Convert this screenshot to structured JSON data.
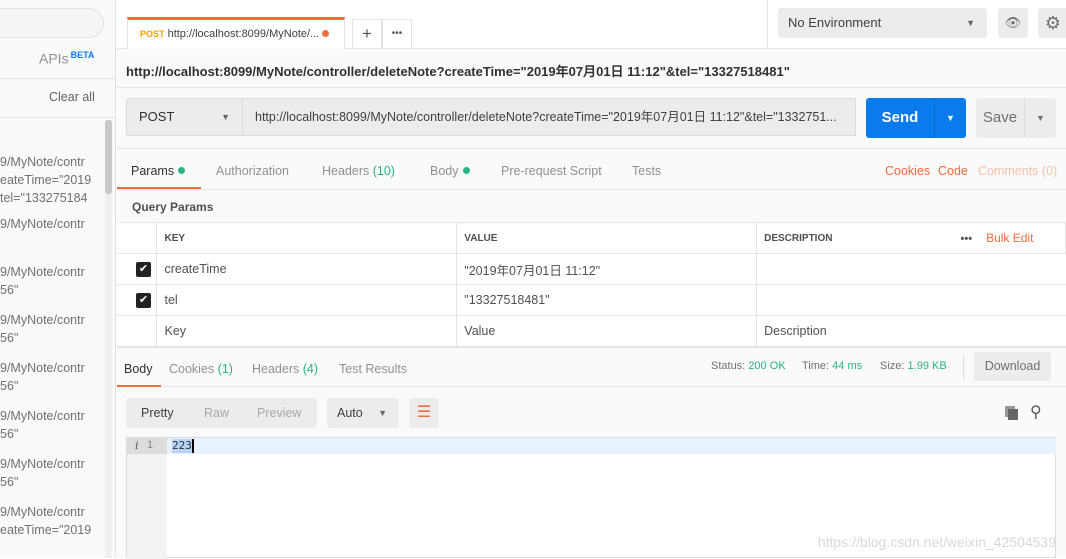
{
  "sidebar": {
    "tabs_apis": "APIs",
    "beta": "BETA",
    "clear_all": "Clear all",
    "history": [
      {
        "l1": "9/MyNote/contr",
        "l2": "eateTime=\"2019",
        "l3": "tel=\"133275184"
      },
      {
        "l1": "9/MyNote/contr"
      },
      {
        "l1": "9/MyNote/contr",
        "l2": "56\""
      },
      {
        "l1": "9/MyNote/contr",
        "l2": "56\""
      },
      {
        "l1": "9/MyNote/contr",
        "l2": "56\""
      },
      {
        "l1": "9/MyNote/contr",
        "l2": "56\""
      },
      {
        "l1": "9/MyNote/contr",
        "l2": "56\""
      },
      {
        "l1": "9/MyNote/contr",
        "l2": "eateTime=\"2019"
      }
    ]
  },
  "tab": {
    "method": "POST",
    "title": "http://localhost:8099/MyNote/...",
    "plus": "+",
    "more": "•••"
  },
  "env": {
    "selected": "No Environment"
  },
  "request": {
    "name": "http://localhost:8099/MyNote/controller/deleteNote?createTime=\"2019年07月01日 11:12\"&tel=\"13327518481\"",
    "method": "POST",
    "url": "http://localhost:8099/MyNote/controller/deleteNote?createTime=\"2019年07月01日 11:12\"&tel=\"1332751...",
    "send": "Send",
    "save": "Save"
  },
  "req_tabs": {
    "params": "Params",
    "authorization": "Authorization",
    "headers": "Headers",
    "headers_count": "(10)",
    "body": "Body",
    "prerequest": "Pre-request Script",
    "tests": "Tests",
    "cookies": "Cookies",
    "code": "Code",
    "comments": "Comments (0)"
  },
  "query": {
    "title": "Query Params",
    "col_key": "KEY",
    "col_value": "VALUE",
    "col_desc": "DESCRIPTION",
    "bulk_edit": "Bulk Edit",
    "rows": [
      {
        "key": "createTime",
        "value": "\"2019年07月01日 11:12\""
      },
      {
        "key": "tel",
        "value": "\"13327518481\""
      }
    ],
    "ph_key": "Key",
    "ph_value": "Value",
    "ph_desc": "Description"
  },
  "response": {
    "body": "Body",
    "cookies": "Cookies",
    "cookies_count": "(1)",
    "headers": "Headers",
    "headers_count": "(4)",
    "test_results": "Test Results",
    "status_label": "Status:",
    "status": "200 OK",
    "time_label": "Time:",
    "time": "44 ms",
    "size_label": "Size:",
    "size": "1.99 KB",
    "download": "Download",
    "pretty": "Pretty",
    "raw": "Raw",
    "preview": "Preview",
    "format": "Auto",
    "line_no": "1",
    "content": "223"
  },
  "watermark": "https://blog.csdn.net/weixin_42504539",
  "colors": {
    "accent": "#f26b3a",
    "send": "#097bed",
    "green": "#26b47f"
  }
}
